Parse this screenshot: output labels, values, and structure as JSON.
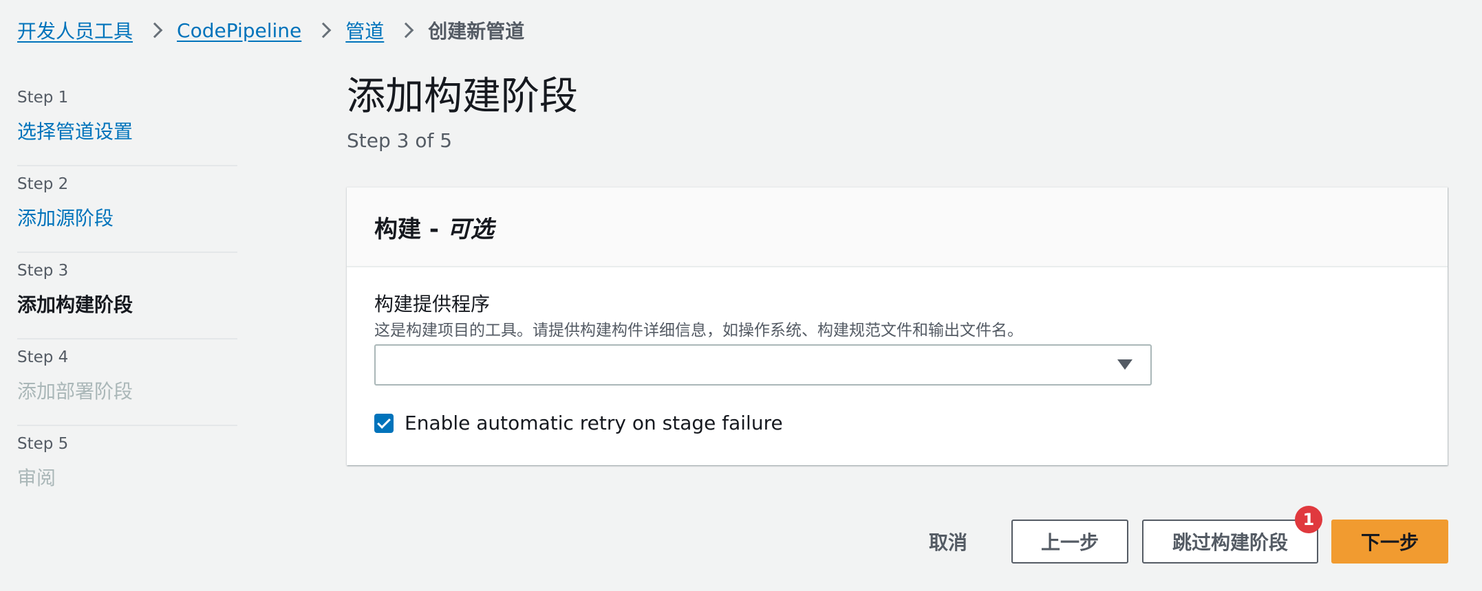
{
  "breadcrumb": {
    "items": [
      {
        "label": "开发人员工具"
      },
      {
        "label": "CodePipeline"
      },
      {
        "label": "管道"
      }
    ],
    "current": "创建新管道"
  },
  "steps": [
    {
      "number": "Step 1",
      "label": "选择管道设置",
      "state": "link"
    },
    {
      "number": "Step 2",
      "label": "添加源阶段",
      "state": "link"
    },
    {
      "number": "Step 3",
      "label": "添加构建阶段",
      "state": "active"
    },
    {
      "number": "Step 4",
      "label": "添加部署阶段",
      "state": "disabled"
    },
    {
      "number": "Step 5",
      "label": "审阅",
      "state": "disabled"
    }
  ],
  "page": {
    "title": "添加构建阶段",
    "subtitle": "Step 3 of 5"
  },
  "container": {
    "title": "构建 - ",
    "title_optional": "可选",
    "field_label": "构建提供程序",
    "field_description": "这是构建项目的工具。请提供构建构件详细信息，如操作系统、构建规范文件和输出文件名。",
    "select_value": "",
    "checkbox_label": "Enable automatic retry on stage failure",
    "checkbox_checked": true
  },
  "actions": {
    "cancel_label": "取消",
    "previous_label": "上一步",
    "skip_label": "跳过构建阶段",
    "next_label": "下一步",
    "badge_count": "1"
  },
  "colors": {
    "link": "#0073bb",
    "primary_button": "#f19b30",
    "badge": "#e0393e",
    "checkbox": "#0073bb",
    "background": "#f2f3f3"
  }
}
